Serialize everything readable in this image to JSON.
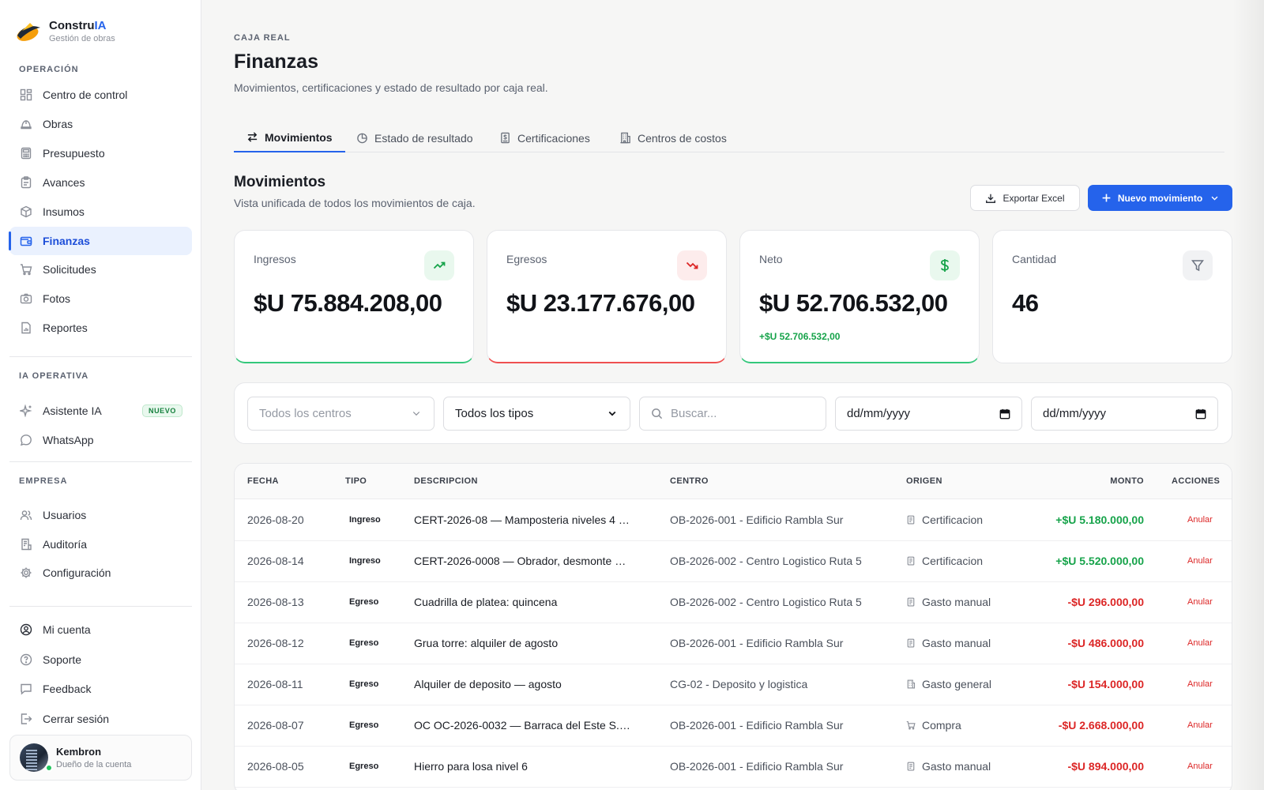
{
  "brand": {
    "name_main": "Constru",
    "name_accent": "IA",
    "subtitle": "Gestión de obras"
  },
  "sidebar": {
    "sections": {
      "operacion": "OPERACIÓN",
      "ia": "IA OPERATIVA",
      "empresa": "EMPRESA"
    },
    "operacion_items": [
      {
        "label": "Centro de control",
        "icon": "grid-icon"
      },
      {
        "label": "Obras",
        "icon": "helmet-icon"
      },
      {
        "label": "Presupuesto",
        "icon": "calculator-icon"
      },
      {
        "label": "Avances",
        "icon": "clipboard-icon"
      },
      {
        "label": "Insumos",
        "icon": "box-icon"
      },
      {
        "label": "Finanzas",
        "icon": "wallet-icon",
        "active": true
      },
      {
        "label": "Solicitudes",
        "icon": "cart-icon"
      },
      {
        "label": "Fotos",
        "icon": "camera-icon"
      },
      {
        "label": "Reportes",
        "icon": "report-icon"
      }
    ],
    "ia_items": [
      {
        "label": "Asistente IA",
        "icon": "sparkle-icon",
        "badge": "NUEVO"
      },
      {
        "label": "WhatsApp",
        "icon": "chat-icon"
      }
    ],
    "empresa_items": [
      {
        "label": "Usuarios",
        "icon": "users-icon"
      },
      {
        "label": "Auditoría",
        "icon": "audit-icon"
      },
      {
        "label": "Configuración",
        "icon": "gear-icon"
      }
    ],
    "footer_items": [
      {
        "label": "Mi cuenta",
        "icon": "user-circle-icon"
      },
      {
        "label": "Soporte",
        "icon": "help-icon"
      },
      {
        "label": "Feedback",
        "icon": "message-icon"
      },
      {
        "label": "Cerrar sesión",
        "icon": "logout-icon"
      }
    ],
    "user": {
      "name": "Kembron",
      "role": "Dueño de la cuenta"
    }
  },
  "header": {
    "kicker": "CAJA REAL",
    "title": "Finanzas",
    "subtitle": "Movimientos, certificaciones y estado de resultado por caja real."
  },
  "tabs": [
    {
      "label": "Movimientos",
      "icon": "swap-icon",
      "active": true
    },
    {
      "label": "Estado de resultado",
      "icon": "pie-icon"
    },
    {
      "label": "Certificaciones",
      "icon": "document-dollar-icon"
    },
    {
      "label": "Centros de costos",
      "icon": "building-icon"
    }
  ],
  "section": {
    "title": "Movimientos",
    "subtitle": "Vista unificada de todos los movimientos de caja.",
    "export_label": "Exportar Excel",
    "new_label": "Nuevo movimiento"
  },
  "kpis": [
    {
      "label": "Ingresos",
      "value": "$U 75.884.208,00",
      "icon": "trend-up-icon",
      "accent": "#16a34a"
    },
    {
      "label": "Egresos",
      "value": "$U 23.177.676,00",
      "icon": "trend-down-icon",
      "accent": "#dc2626"
    },
    {
      "label": "Neto",
      "value": "$U 52.706.532,00",
      "delta": "+$U 52.706.532,00",
      "icon": "dollar-icon",
      "accent": "#16a34a"
    },
    {
      "label": "Cantidad",
      "value": "46",
      "icon": "filter-icon",
      "accent": "#6b7280"
    }
  ],
  "filters": {
    "centro_placeholder": "Todos los centros",
    "tipo_value": "Todos los tipos",
    "search_placeholder": "Buscar...",
    "date_from": "dd/mm/yyyy",
    "date_to": "dd/mm/yyyy"
  },
  "table": {
    "headers": {
      "fecha": "FECHA",
      "tipo": "TIPO",
      "descripcion": "DESCRIPCION",
      "centro": "CENTRO",
      "origen": "ORIGEN",
      "monto": "MONTO",
      "acciones": "ACCIONES"
    },
    "rows": [
      {
        "fecha": "2026-08-20",
        "tipo": "Ingreso",
        "descripcion": "CERT-2026-08 — Mamposteria niveles 4 …",
        "centro": "OB-2026-001 - Edificio Rambla Sur",
        "origen": "Certificacion",
        "origen_icon": "document-icon",
        "monto": "+$U 5.180.000,00",
        "sign": "pos",
        "accion": "Anular"
      },
      {
        "fecha": "2026-08-14",
        "tipo": "Ingreso",
        "descripcion": "CERT-2026-0008 — Obrador, desmonte …",
        "centro": "OB-2026-002 - Centro Logistico Ruta 5",
        "origen": "Certificacion",
        "origen_icon": "document-icon",
        "monto": "+$U 5.520.000,00",
        "sign": "pos",
        "accion": "Anular"
      },
      {
        "fecha": "2026-08-13",
        "tipo": "Egreso",
        "descripcion": "Cuadrilla de platea: quincena",
        "centro": "OB-2026-002 - Centro Logistico Ruta 5",
        "origen": "Gasto manual",
        "origen_icon": "receipt-icon",
        "monto": "-$U 296.000,00",
        "sign": "neg",
        "accion": "Anular"
      },
      {
        "fecha": "2026-08-12",
        "tipo": "Egreso",
        "descripcion": "Grua torre: alquiler de agosto",
        "centro": "OB-2026-001 - Edificio Rambla Sur",
        "origen": "Gasto manual",
        "origen_icon": "receipt-icon",
        "monto": "-$U 486.000,00",
        "sign": "neg",
        "accion": "Anular"
      },
      {
        "fecha": "2026-08-11",
        "tipo": "Egreso",
        "descripcion": "Alquiler de deposito — agosto",
        "centro": "CG-02 - Deposito y logistica",
        "origen": "Gasto general",
        "origen_icon": "building-icon",
        "monto": "-$U 154.000,00",
        "sign": "neg",
        "accion": "Anular"
      },
      {
        "fecha": "2026-08-07",
        "tipo": "Egreso",
        "descripcion": "OC OC-2026-0032 — Barraca del Este S.…",
        "centro": "OB-2026-001 - Edificio Rambla Sur",
        "origen": "Compra",
        "origen_icon": "cart-icon",
        "monto": "-$U 2.668.000,00",
        "sign": "neg",
        "accion": "Anular"
      },
      {
        "fecha": "2026-08-05",
        "tipo": "Egreso",
        "descripcion": "Hierro para losa nivel 6",
        "centro": "OB-2026-001 - Edificio Rambla Sur",
        "origen": "Gasto manual",
        "origen_icon": "receipt-icon",
        "monto": "-$U 894.000,00",
        "sign": "neg",
        "accion": "Anular"
      }
    ]
  }
}
